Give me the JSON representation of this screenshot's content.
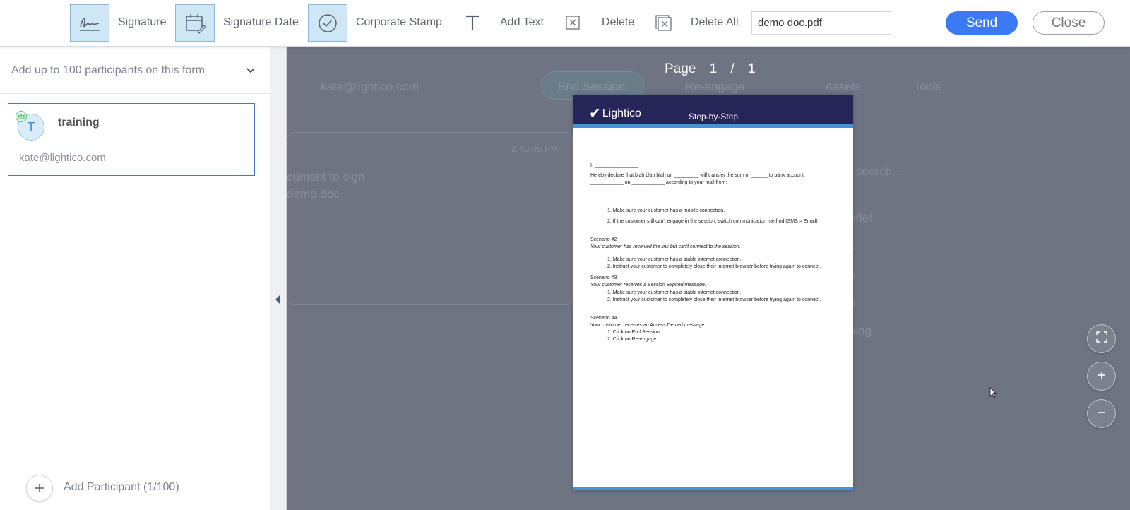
{
  "toolbar": {
    "signature_label": "Signature",
    "signature_date_label": "Signature Date",
    "corporate_stamp_label": "Corporate Stamp",
    "add_text_label": "Add Text",
    "delete_label": "Delete",
    "delete_all_label": "Delete All",
    "filename_value": "demo doc.pdf",
    "send_label": "Send",
    "close_label": "Close"
  },
  "sidebar": {
    "participants_dropdown": "Add up to 100 participants on this form",
    "participant": {
      "initial": "T",
      "name": "training",
      "email": "kate@lightico.com"
    },
    "add_participant_label": "Add Participant (1/100)"
  },
  "background": {
    "contact": "kate@lightico.com",
    "end_session": "End Session",
    "re_engage": "Re-engage",
    "assets_tab": "Assets",
    "tools_tab": "Tools",
    "timestamp": "2:40:05 PM",
    "message_line1": "cument to sign",
    "message_line2": "demo doc",
    "search_placeholder": "o search...",
    "list": [
      "erie!",
      "k",
      "o",
      "n",
      "ning"
    ]
  },
  "viewer": {
    "page_word": "Page",
    "page_current": "1",
    "page_sep": "/",
    "page_total": "1"
  },
  "document": {
    "brand": "Lightico",
    "header_title": "Step-by-Step",
    "line_name": "I, ________________",
    "line_declare": "Hereby declare that blah blah blah on _________ will transfer the sum of ______ to bank account ____________ on ____________ according to your mail from:",
    "s1_item1": "1.   Make sure your customer has a mobile connection.",
    "s1_item2": "2.   If the customer still can't engage in the session, switch communication method (SMS > Email)",
    "s2_title": "Scenario #2",
    "s2_desc": "Your customer has received the link but can't connect to the session.",
    "s2_item1": "1.   Make sure your customer has a stable internet connection.",
    "s2_item2": "2.   Instruct your customer to completely close their internet browser before trying again to connect.",
    "s3_title": "Scenario #3",
    "s3_desc": "Your customer receives a Session Expired message.",
    "s3_item1": "1.   Make sure your customer has a stable internet connection.",
    "s3_item2": "2.   Instruct your customer to completely close their internet browser before trying again to connect.",
    "s4_title": "Scenario #4",
    "s4_desc": "Your customer receives an Access Denied message.",
    "s4_item1": "1.   Click on End Session",
    "s4_item2": "2.   Click on Re-engage"
  },
  "colors": {
    "accent": "#3a7af5",
    "header_navy": "#262557",
    "stripe_blue": "#4a90d9"
  }
}
